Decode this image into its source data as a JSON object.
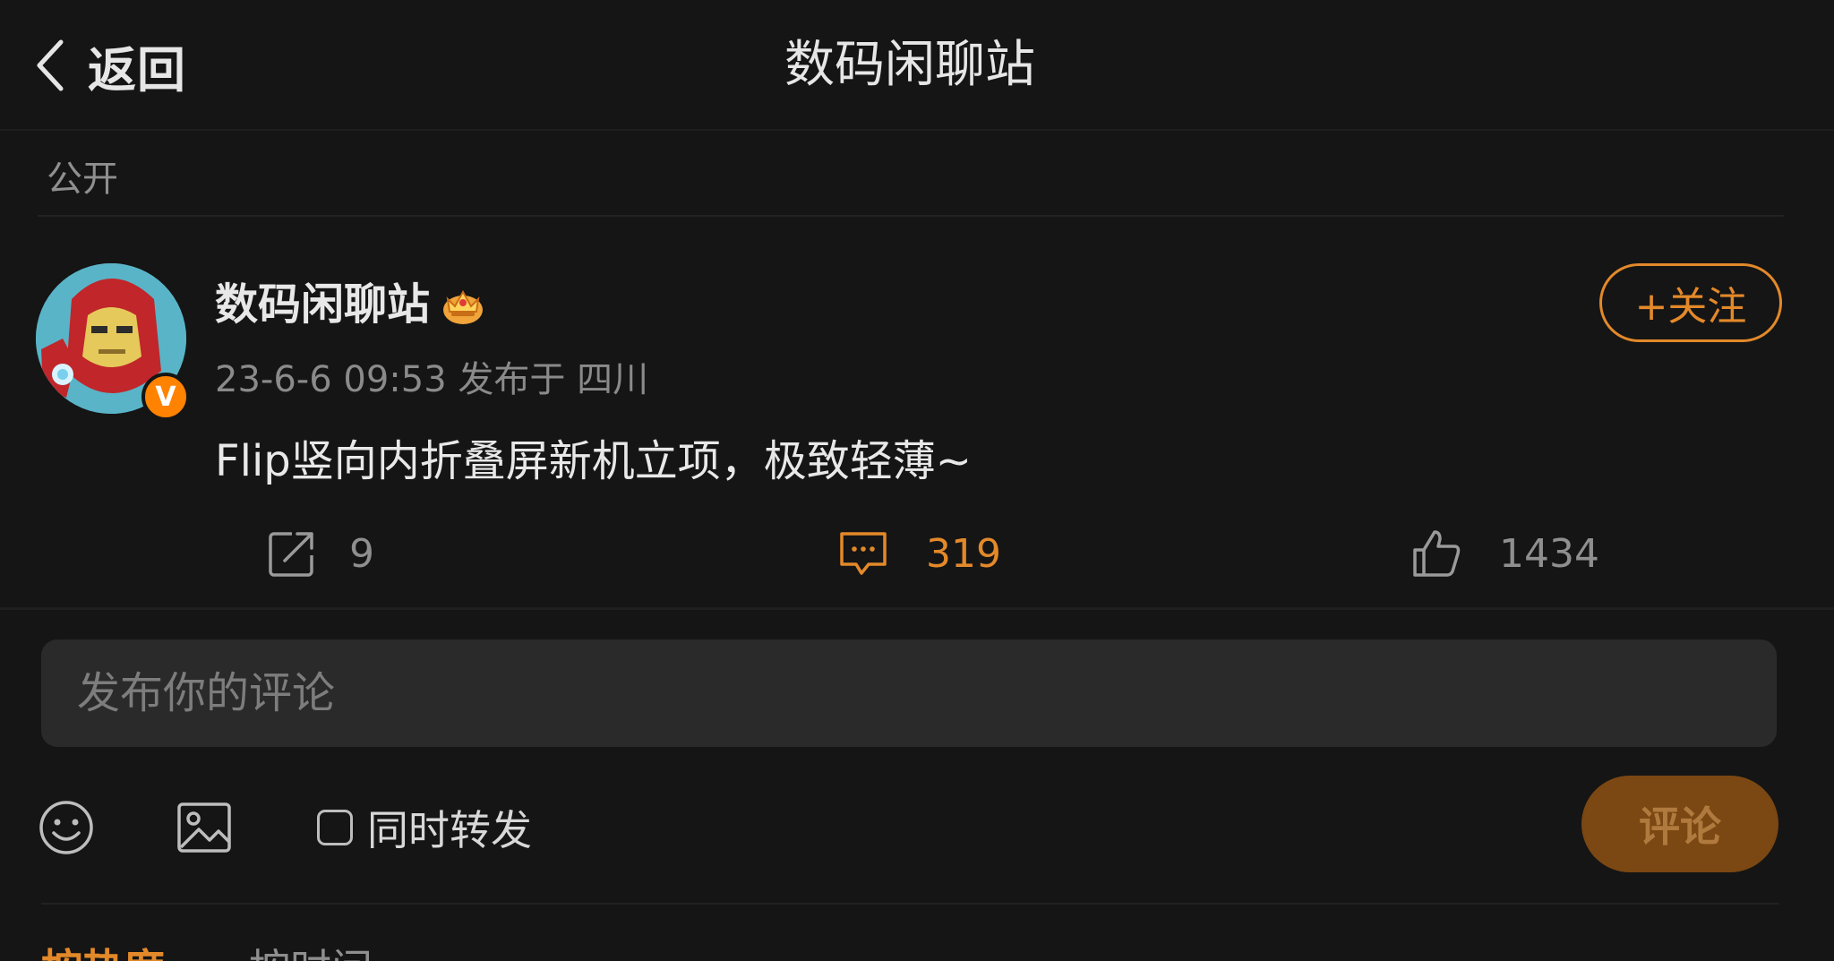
{
  "header": {
    "back_label": "返回",
    "title": "数码闲聊站"
  },
  "post": {
    "visibility": "公开",
    "author": {
      "name": "数码闲聊站",
      "verified_mark": "V",
      "avatar": "iron-man-avatar",
      "badge_icon": "crown-icon"
    },
    "meta": "23-6-6 09:53 发布于 四川",
    "content": "Flip竖向内折叠屏新机立项，极致轻薄~",
    "follow_label": "+关注",
    "stats": {
      "reposts": "9",
      "comments": "319",
      "likes": "1434"
    }
  },
  "comment_box": {
    "placeholder": "发布你的评论",
    "repost_option_label": "同时转发",
    "repost_checked": false,
    "submit_label": "评论"
  },
  "sort_tabs": {
    "hot_label": "按热度",
    "time_label": "按时间"
  },
  "colors": {
    "accent": "#e3892a",
    "background": "#151515",
    "input_background": "#2a2a2a",
    "submit_disabled": "#7b4712"
  }
}
